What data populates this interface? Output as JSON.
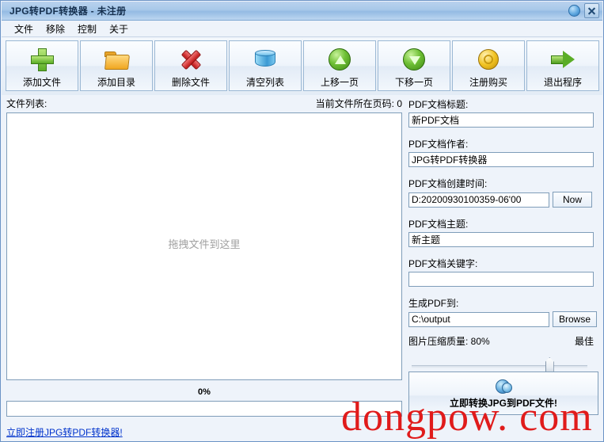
{
  "window": {
    "title": "JPG转PDF转换器 - 未注册",
    "controls": [
      {
        "name": "globe-button",
        "label": ""
      },
      {
        "name": "close-button",
        "label": ""
      }
    ]
  },
  "menu": {
    "items": [
      {
        "label": "文件"
      },
      {
        "label": "移除"
      },
      {
        "label": "控制"
      },
      {
        "label": "关于"
      }
    ]
  },
  "toolbar": {
    "buttons": [
      {
        "label": "添加文件",
        "icon": "plus-icon"
      },
      {
        "label": "添加目录",
        "icon": "folder-icon"
      },
      {
        "label": "删除文件",
        "icon": "red-x-icon"
      },
      {
        "label": "清空列表",
        "icon": "database-icon"
      },
      {
        "label": "上移一页",
        "icon": "arrow-up-circle-icon"
      },
      {
        "label": "下移一页",
        "icon": "arrow-down-circle-icon"
      },
      {
        "label": "注册购买",
        "icon": "coin-icon"
      },
      {
        "label": "退出程序",
        "icon": "arrow-right-icon"
      }
    ]
  },
  "left": {
    "list_label": "文件列表:",
    "page_info": "当前文件所在页码: 0",
    "drop_hint": "拖拽文件到这里",
    "progress_percent_label": "0%",
    "progress_value": 0,
    "register_link": "立即注册JPG转PDF转换器!"
  },
  "right": {
    "title_label": "PDF文档标题:",
    "title_value": "新PDF文档",
    "author_label": "PDF文档作者:",
    "author_value": "JPG转PDF转换器",
    "created_label": "PDF文档创建时间:",
    "created_value": "D:20200930100359-06'00",
    "now_button": "Now",
    "subject_label": "PDF文档主题:",
    "subject_value": "新主题",
    "keywords_label": "PDF文档关键字:",
    "keywords_value": "",
    "keywords_placeholder": "",
    "output_label": "生成PDF到:",
    "output_value": "C:\\output",
    "browse_button": "Browse",
    "quality_label": "图片压缩质量: 80%",
    "quality_best_label": "最佳",
    "quality_value": 80,
    "convert_button": "立即转换JPG到PDF文件!"
  },
  "watermark": {
    "text": "dongpow. com",
    "color": "#e01b1b"
  },
  "colors": {
    "titlebar": "#a8c8e9",
    "panel_bg": "#eef3fa",
    "border": "#7f9db9",
    "link": "#0033cc"
  }
}
